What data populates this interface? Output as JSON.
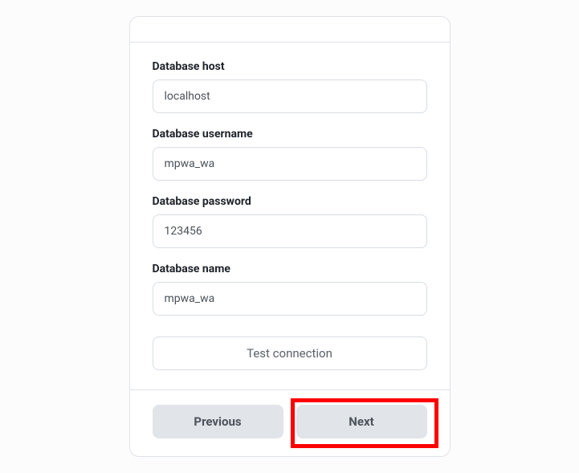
{
  "form": {
    "host": {
      "label": "Database host",
      "value": "localhost"
    },
    "username": {
      "label": "Database username",
      "value": "mpwa_wa"
    },
    "password": {
      "label": "Database password",
      "value": "123456"
    },
    "name": {
      "label": "Database name",
      "value": "mpwa_wa"
    },
    "test_button": "Test connection"
  },
  "footer": {
    "previous": "Previous",
    "next": "Next"
  }
}
